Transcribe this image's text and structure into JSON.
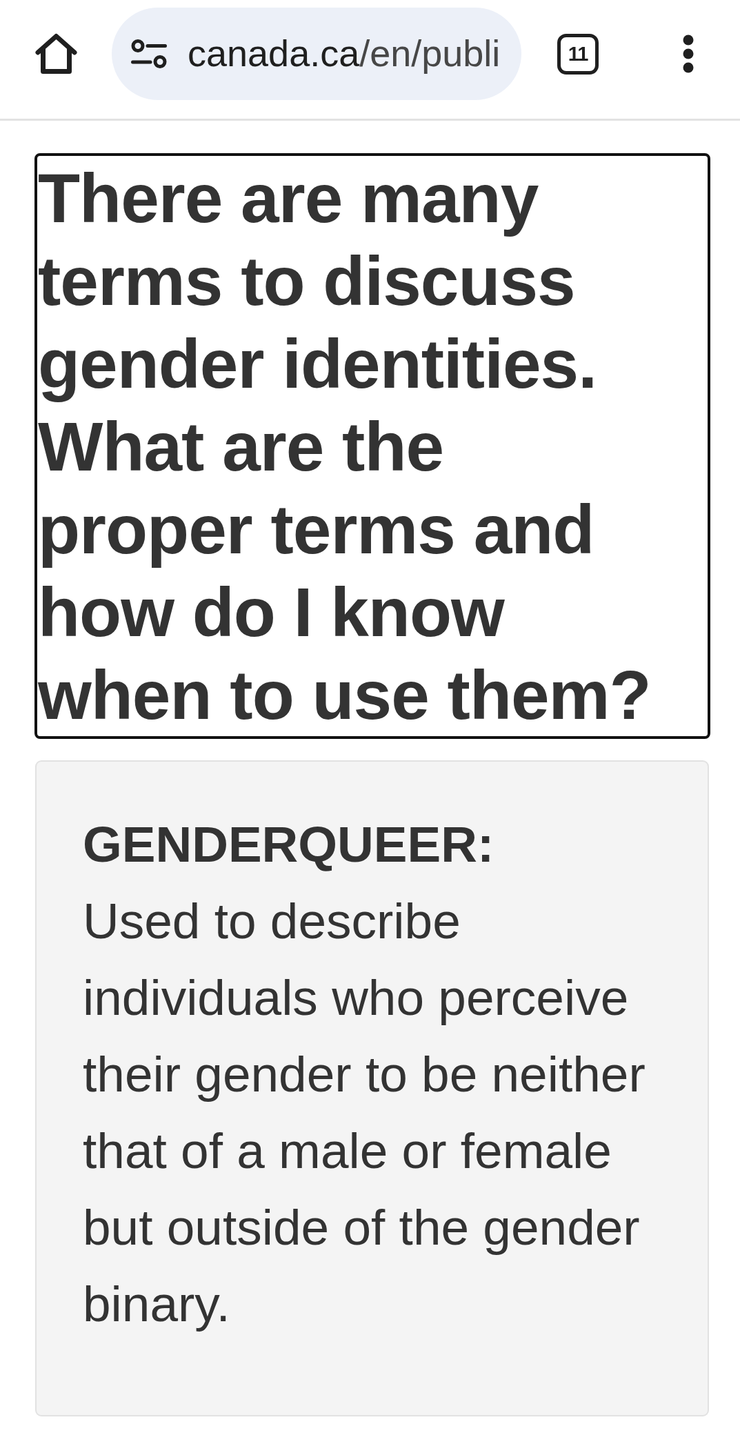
{
  "browser_bar": {
    "url": {
      "host": "canada.ca",
      "path": "/en/publi"
    },
    "tab_count": "11"
  },
  "heading": "There are many terms to discuss gender identities. What are the proper terms and how do I know when to use them?",
  "definition": {
    "term": "GENDERQUEER:",
    "text": "Used to describe individuals who perceive their gender to be neither that of a male or female but outside of the gender binary."
  }
}
